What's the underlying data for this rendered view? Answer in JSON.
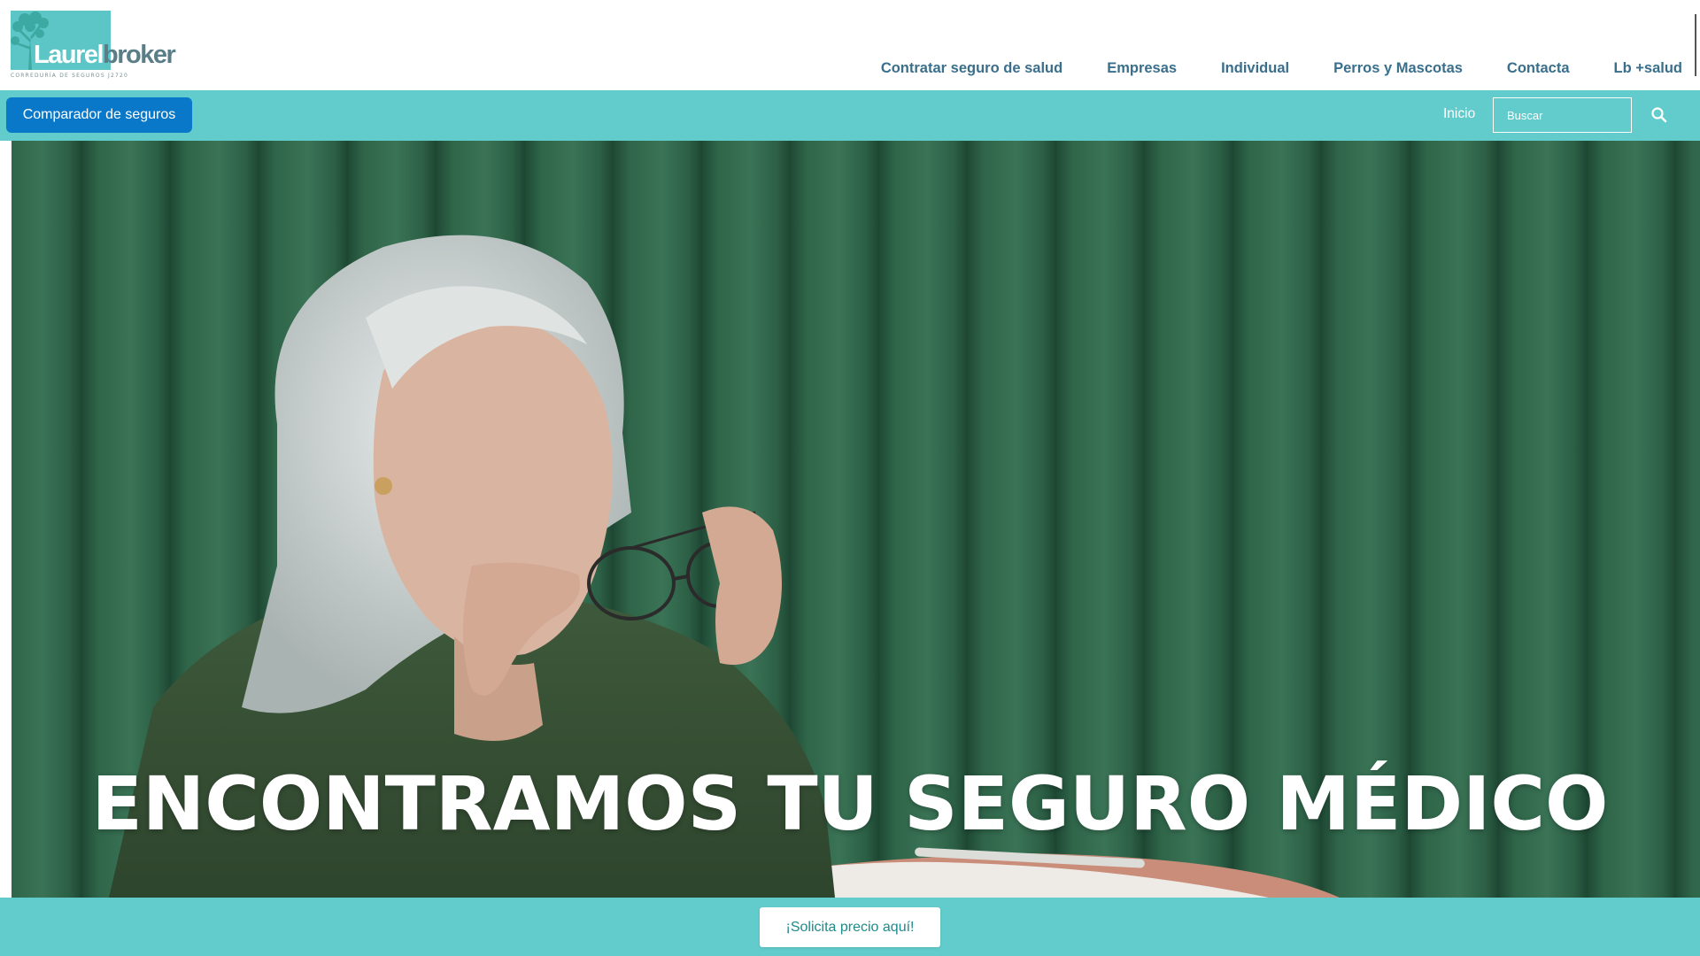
{
  "brand": {
    "name_part1": "Laurel",
    "name_part2": "broker",
    "tagline": "CORREDURÍA DE SEGUROS J2720",
    "logo_color": "#5cc6c6"
  },
  "main_nav": [
    {
      "label": "Contratar seguro de salud"
    },
    {
      "label": "Empresas"
    },
    {
      "label": "Individual"
    },
    {
      "label": "Perros y Mascotas"
    },
    {
      "label": "Contacta"
    },
    {
      "label": "Lb +salud"
    }
  ],
  "subbar": {
    "compare_button": "Comparador de seguros",
    "home_link": "Inicio",
    "search_placeholder": "Buscar",
    "search_icon": "magnifier-icon",
    "bar_color": "#62cbcb",
    "button_color": "#0a78c8"
  },
  "hero": {
    "title": "ENCONTRAMOS TU SEGURO MÉDICO",
    "image": "older woman with white hair removing glasses in front of green velvet panels"
  },
  "cta": {
    "quote_button": "¡Solicita precio aquí!"
  },
  "colors": {
    "nav_text": "#3a6f8c",
    "hero_bg": "#2f6148"
  }
}
